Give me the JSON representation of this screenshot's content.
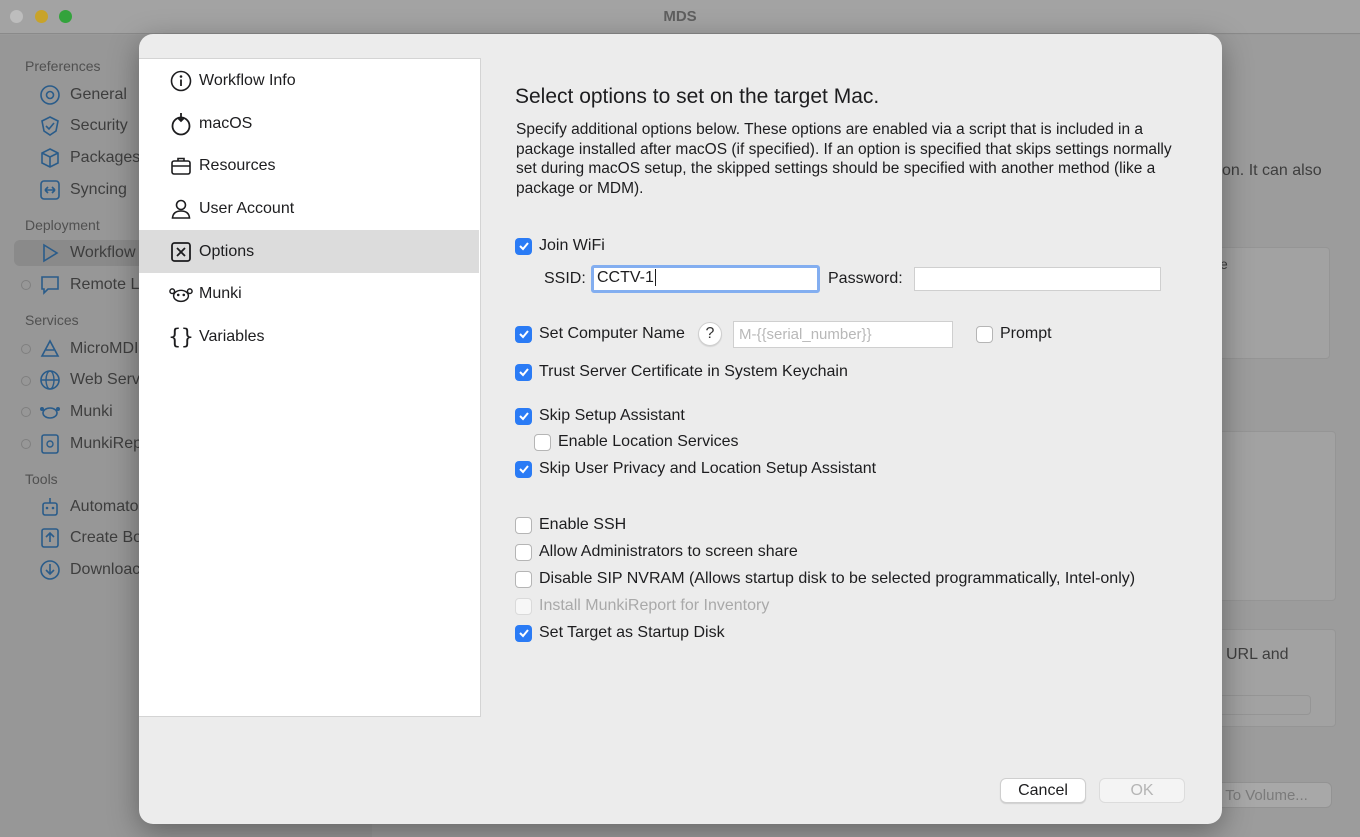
{
  "window": {
    "title": "MDS"
  },
  "sidebar": {
    "sections": [
      {
        "label": "Preferences"
      },
      {
        "label": "Deployment"
      },
      {
        "label": "Services"
      },
      {
        "label": "Tools"
      }
    ],
    "items": [
      {
        "label": "General",
        "icon": "gear-icon"
      },
      {
        "label": "Security",
        "icon": "shield-check-icon"
      },
      {
        "label": "Packages",
        "icon": "box-icon"
      },
      {
        "label": "Syncing",
        "icon": "sync-icon"
      },
      {
        "label": "Workflow",
        "icon": "play-icon"
      },
      {
        "label": "Remote L",
        "icon": "chat-icon"
      },
      {
        "label": "MicroMDI",
        "icon": "micromdm-icon"
      },
      {
        "label": "Web Serv",
        "icon": "globe-icon"
      },
      {
        "label": "Munki",
        "icon": "munki-icon"
      },
      {
        "label": "MunkiRep",
        "icon": "munkireport-icon"
      },
      {
        "label": "Automato",
        "icon": "robot-icon"
      },
      {
        "label": "Create Bo",
        "icon": "upload-doc-icon"
      },
      {
        "label": "Downloac",
        "icon": "download-icon"
      }
    ]
  },
  "background": {
    "text_1": "on. It can also",
    "text_2": "e",
    "text_3": "URL and",
    "button": "e To Volume..."
  },
  "sheet": {
    "nav": [
      {
        "label": "Workflow Info",
        "icon": "info-icon"
      },
      {
        "label": "macOS",
        "icon": "macos-installer-icon"
      },
      {
        "label": "Resources",
        "icon": "briefcase-icon"
      },
      {
        "label": "User Account",
        "icon": "person-icon"
      },
      {
        "label": "Options",
        "icon": "x-square-icon"
      },
      {
        "label": "Munki",
        "icon": "munki-icon"
      },
      {
        "label": "Variables",
        "icon": "braces-icon"
      }
    ],
    "heading": "Select options to set on the target Mac.",
    "description": "Specify additional options below. These options are enabled via a script that is included in a package installed after macOS (if specified). If an option is specified that skips settings normally set during macOS setup, the skipped settings should be specified with another method (like a package or MDM).",
    "join_wifi": {
      "label": "Join WiFi",
      "checked": true
    },
    "ssid": {
      "label": "SSID:",
      "value": "CCTV-1"
    },
    "password": {
      "label": "Password:",
      "value": ""
    },
    "set_computer_name": {
      "label": "Set Computer Name",
      "checked": true,
      "help": "?",
      "placeholder": "M-{{serial_number}}"
    },
    "prompt": {
      "label": "Prompt",
      "checked": false
    },
    "trust_cert": {
      "label": "Trust Server Certificate in System Keychain",
      "checked": true
    },
    "skip_setup": {
      "label": "Skip Setup Assistant",
      "checked": true
    },
    "enable_location": {
      "label": "Enable Location Services",
      "checked": false
    },
    "skip_privacy": {
      "label": "Skip User Privacy and Location Setup Assistant",
      "checked": true
    },
    "enable_ssh": {
      "label": "Enable SSH",
      "checked": false
    },
    "allow_admins": {
      "label": "Allow Administrators to screen share",
      "checked": false
    },
    "disable_sip": {
      "label": "Disable SIP NVRAM (Allows startup disk to be selected programmatically, Intel-only)",
      "checked": false
    },
    "install_munkireport": {
      "label": "Install MunkiReport for Inventory",
      "checked": false,
      "disabled": true
    },
    "set_target": {
      "label": "Set Target as Startup Disk",
      "checked": true
    },
    "cancel": "Cancel",
    "ok": "OK"
  },
  "colors": {
    "accent": "#2a7bf5",
    "focus_ring": "#83aef0",
    "selected_nav": "#dcdcdc"
  }
}
